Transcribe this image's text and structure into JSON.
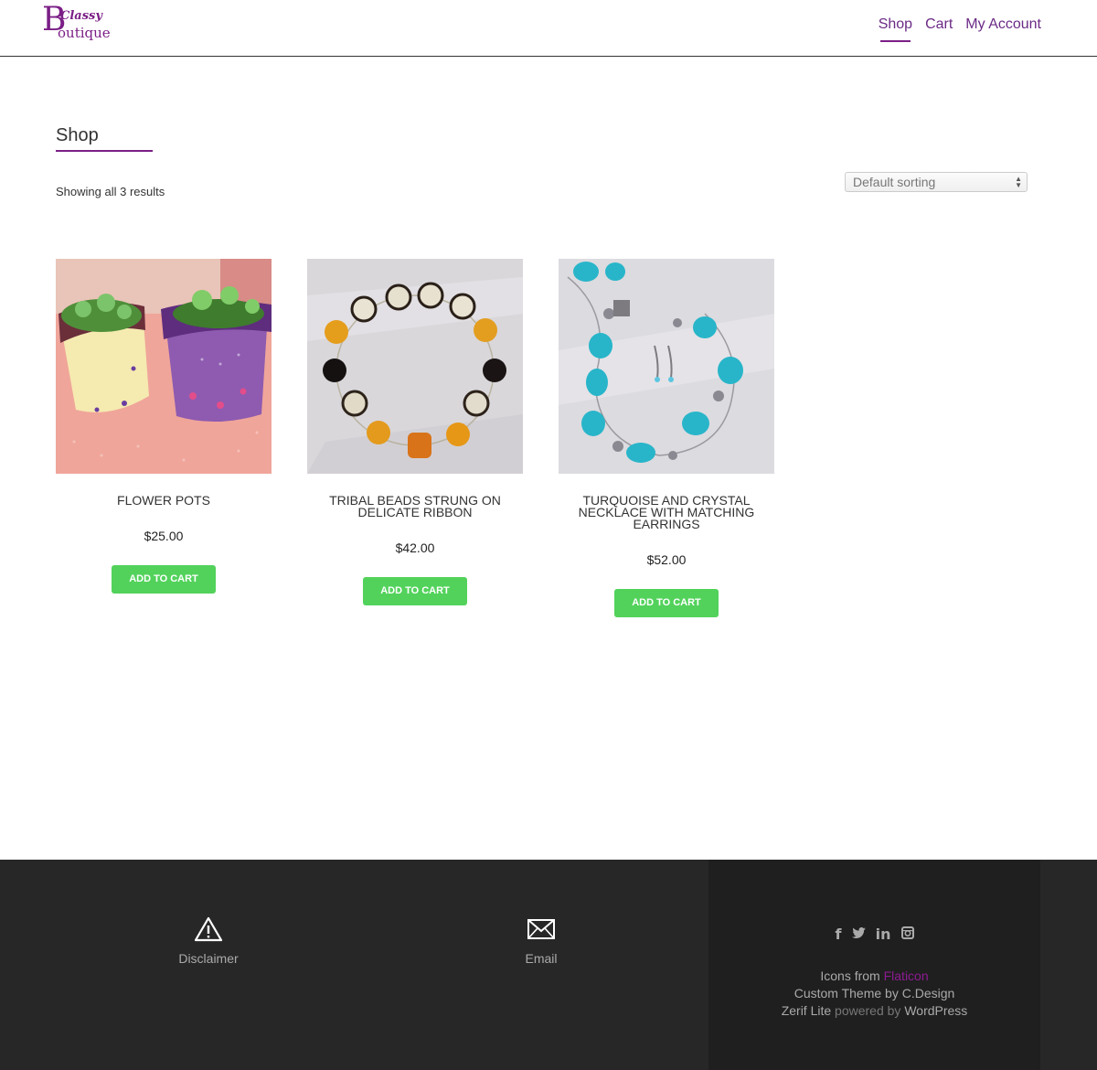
{
  "header": {
    "logo": {
      "initial": "B",
      "top_word": "Classy",
      "bottom_word": "outique"
    },
    "nav": [
      {
        "label": "Shop",
        "active": true
      },
      {
        "label": "Cart",
        "active": false
      },
      {
        "label": "My Account",
        "active": false
      }
    ]
  },
  "main": {
    "title": "Shop",
    "result_count": "Showing all 3 results",
    "sort": {
      "selected": "Default sorting"
    }
  },
  "products": [
    {
      "name": "FLOWER POTS",
      "price": "$25.00",
      "button": "ADD TO CART"
    },
    {
      "name": "TRIBAL BEADS STRUNG ON DELICATE RIBBON",
      "price": "$42.00",
      "button": "ADD TO CART"
    },
    {
      "name": "TURQUOISE AND CRYSTAL NECKLACE WITH MATCHING EARRINGS",
      "price": "$52.00",
      "button": "ADD TO CART"
    }
  ],
  "footer": {
    "disclaimer": {
      "icon": "warning-icon",
      "label": "Disclaimer"
    },
    "email": {
      "icon": "envelope-icon",
      "label": "Email"
    },
    "socials": [
      "facebook-icon",
      "twitter-icon",
      "linkedin-icon",
      "instagram-icon"
    ],
    "credits": {
      "icons_prefix": "Icons from",
      "icons_link": "Flaticon",
      "custom_theme": "Custom Theme by C.Design",
      "theme_name": "Zerif Lite",
      "powered_by": "powered by",
      "platform": "WordPress"
    }
  },
  "colors": {
    "brand": "#7b1f86",
    "button": "#52d25b",
    "footer": "#272727"
  }
}
